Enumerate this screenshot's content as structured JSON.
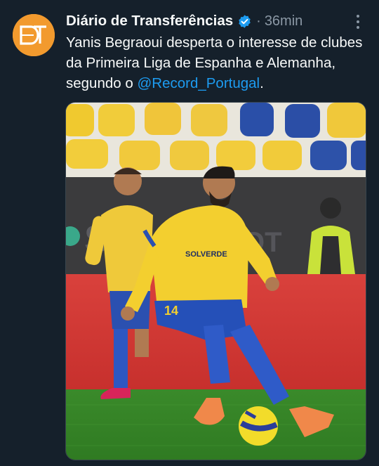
{
  "account": {
    "display_name": "Diário de Transferências",
    "verified_icon": "verified-badge-icon",
    "separator": "·",
    "timestamp": "36min",
    "avatar_logo": "DT"
  },
  "tweet": {
    "text_main": "Yanis Begraoui desperta o interesse de clubes da Primeira Liga de Espanha e Alemanha, segundo o ",
    "mention": "@Record_Portugal",
    "text_end": "."
  },
  "media": {
    "jersey_number": "14",
    "sponsor": "SOLVERDE",
    "board_text": "S",
    "board_text_right": "OT"
  },
  "colors": {
    "background": "#15202b",
    "link": "#1d9bf0",
    "avatar": "#f29a2e",
    "jersey_yellow": "#f3cf2f",
    "shorts_blue": "#2550b8",
    "pitch_green": "#3f8f2a"
  },
  "icons": [
    "more-options-icon",
    "verified-badge-icon"
  ]
}
